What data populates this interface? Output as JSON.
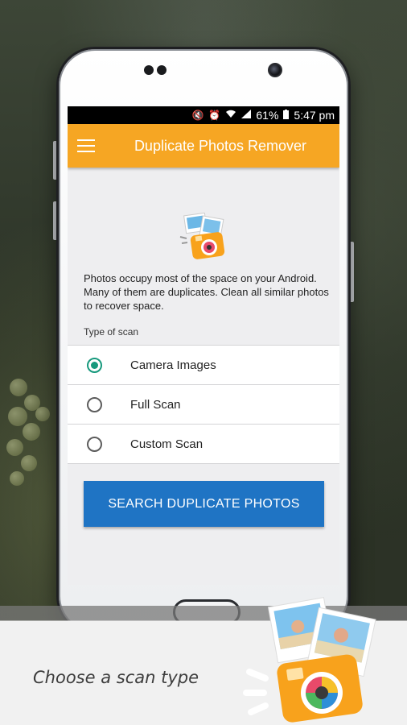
{
  "status_bar": {
    "battery": "61%",
    "time": "5:47 pm",
    "icons": [
      "mute-icon",
      "alarm-icon",
      "wifi-icon",
      "signal-icon",
      "battery-icon"
    ]
  },
  "app_bar": {
    "menu_icon": "hamburger-menu-icon",
    "title": "Duplicate Photos Remover",
    "color": "#f6a623"
  },
  "main": {
    "description": "Photos occupy most of the space on your Android. Many of them are duplicates. Clean all similar photos to recover space.",
    "scan_type_label": "Type of scan",
    "scan_options": [
      {
        "label": "Camera Images",
        "selected": true
      },
      {
        "label": "Full Scan",
        "selected": false
      },
      {
        "label": "Custom Scan",
        "selected": false
      }
    ],
    "search_button": "SEARCH DUPLICATE PHOTOS",
    "button_color": "#1f74c4",
    "radio_color": "#17997d"
  },
  "caption": {
    "text": "Choose a scan type"
  }
}
